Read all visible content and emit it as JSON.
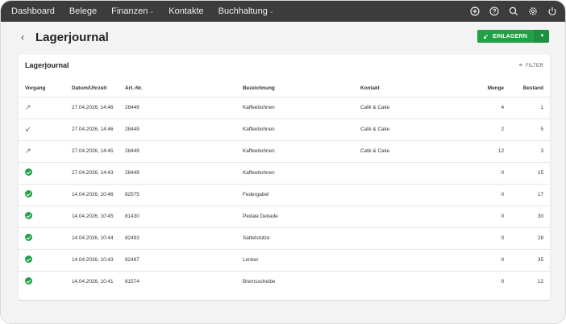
{
  "nav": {
    "items": [
      {
        "label": "Dashboard",
        "dropdown": false
      },
      {
        "label": "Belege",
        "dropdown": false
      },
      {
        "label": "Finanzen",
        "dropdown": true
      },
      {
        "label": "Kontakte",
        "dropdown": false
      },
      {
        "label": "Buchhaltung",
        "dropdown": true
      }
    ],
    "icons": [
      "add-circle-icon",
      "help-icon",
      "search-icon",
      "gear-icon",
      "power-icon"
    ]
  },
  "header": {
    "back_icon": "chevron-left-icon",
    "title": "Lagerjournal",
    "action_label": "EINLAGERN",
    "action_color": "#22a046"
  },
  "card": {
    "title": "Lagerjournal",
    "filter_label": "FILTER"
  },
  "table": {
    "columns": [
      "Vorgang",
      "Datum/Uhrzeit",
      "Art.-Nr.",
      "Bezeichnung",
      "Kontakt",
      "Menge",
      "Bestand"
    ],
    "rows": [
      {
        "vorgang": "outgoing-arrow-icon",
        "datum": "27.04.2026, 14:46",
        "art": "28449",
        "bez": "Kaffeebohnen",
        "kontakt": "Café & Cake",
        "menge": "4",
        "bestand": "1"
      },
      {
        "vorgang": "incoming-arrow-icon",
        "datum": "27.04.2026, 14:46",
        "art": "28449",
        "bez": "Kaffeebohnen",
        "kontakt": "Café & Cake",
        "menge": "2",
        "bestand": "5"
      },
      {
        "vorgang": "outgoing-arrow-icon",
        "datum": "27.04.2026, 14:45",
        "art": "28449",
        "bez": "Kaffeebohnen",
        "kontakt": "Café & Cake",
        "menge": "12",
        "bestand": "3"
      },
      {
        "vorgang": "check-circle-icon",
        "datum": "27.04.2026, 14:43",
        "art": "28449",
        "bez": "Kaffeebohnen",
        "kontakt": "",
        "menge": "0",
        "bestand": "15"
      },
      {
        "vorgang": "check-circle-icon",
        "datum": "14.04.2026, 10:46",
        "art": "82575",
        "bez": "Federgabel",
        "kontakt": "",
        "menge": "0",
        "bestand": "17"
      },
      {
        "vorgang": "check-circle-icon",
        "datum": "14.04.2026, 10:45",
        "art": "81430",
        "bez": "Pedale Dekade",
        "kontakt": "",
        "menge": "0",
        "bestand": "30"
      },
      {
        "vorgang": "check-circle-icon",
        "datum": "14.04.2026, 10:44",
        "art": "82493",
        "bez": "Sattelstütze",
        "kontakt": "",
        "menge": "0",
        "bestand": "28"
      },
      {
        "vorgang": "check-circle-icon",
        "datum": "14.04.2026, 10:43",
        "art": "82487",
        "bez": "Lenker",
        "kontakt": "",
        "menge": "0",
        "bestand": "35"
      },
      {
        "vorgang": "check-circle-icon",
        "datum": "14.04.2026, 10:41",
        "art": "81574",
        "bez": "Bremsscheibe",
        "kontakt": "",
        "menge": "0",
        "bestand": "12"
      }
    ]
  }
}
